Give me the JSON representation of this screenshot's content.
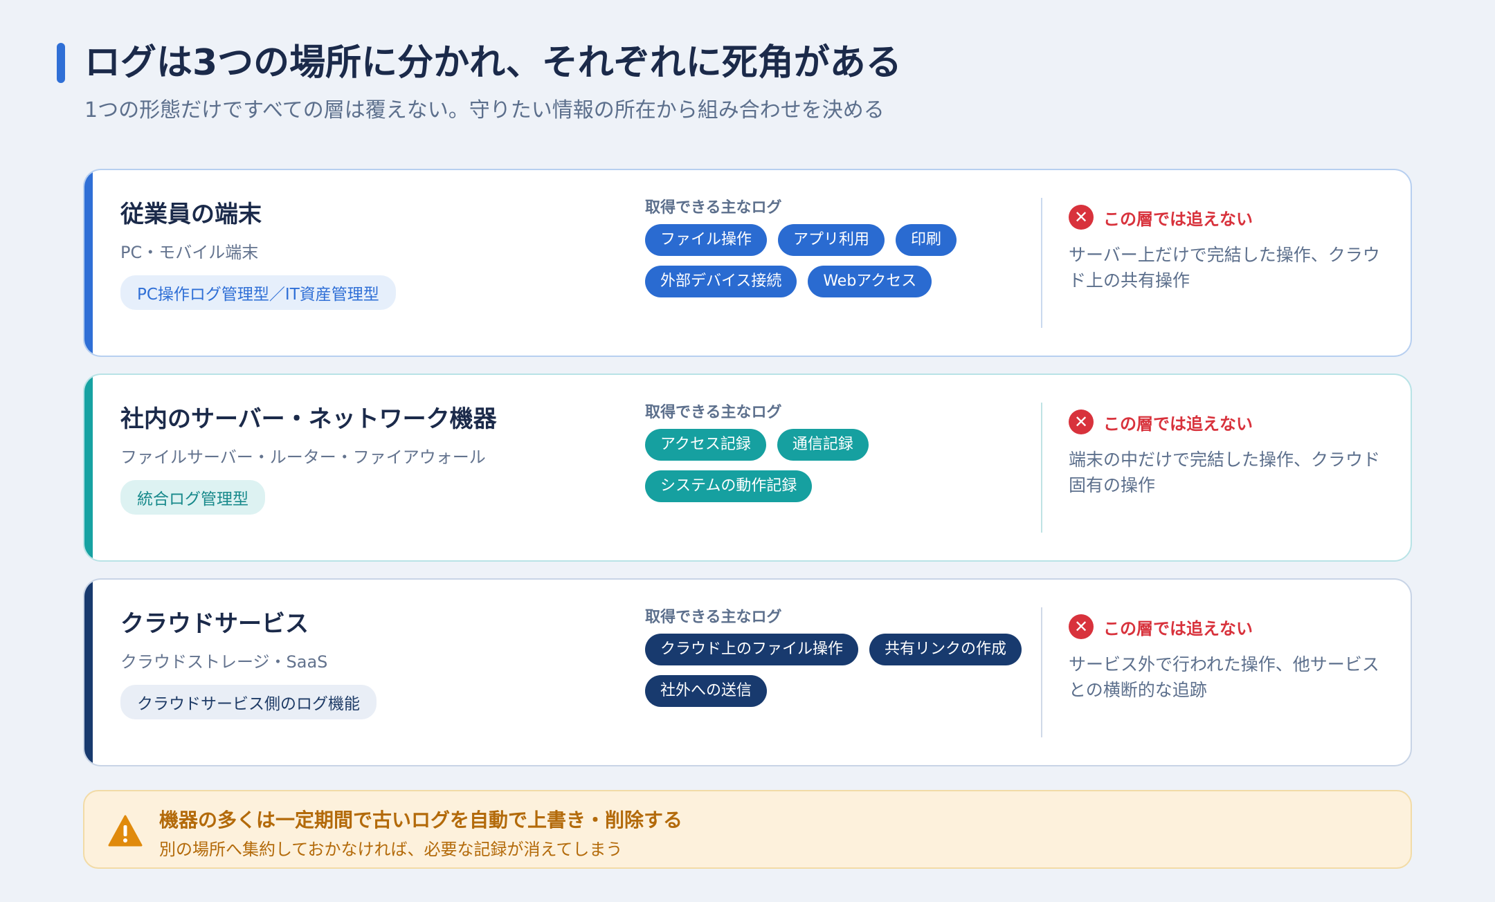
{
  "header": {
    "title": "ログは3つの場所に分かれ、それぞれに死角がある",
    "subtitle": "1つの形態だけですべての層は覆えない。守りたい情報の所在から組み合わせを決める"
  },
  "cards": [
    {
      "title": "従業員の端末",
      "subtitle": "PC・モバイル端末",
      "type_tag": "PC操作ログ管理型／IT資産管理型",
      "logs_label": "取得できる主なログ",
      "logs": [
        "ファイル操作",
        "アプリ利用",
        "印刷",
        "外部デバイス接続",
        "Webアクセス"
      ],
      "blind_label": "この層では追えない",
      "blind_text": "サーバー上だけで完結した操作、クラウド上の共有操作",
      "accent_color": "#2f6fd6"
    },
    {
      "title": "社内のサーバー・ネットワーク機器",
      "subtitle": "ファイルサーバー・ルーター・ファイアウォール",
      "type_tag": "統合ログ管理型",
      "logs_label": "取得できる主なログ",
      "logs": [
        "アクセス記録",
        "通信記録",
        "システムの動作記録"
      ],
      "blind_label": "この層では追えない",
      "blind_text": "端末の中だけで完結した操作、クラウド固有の操作",
      "accent_color": "#17a2a2"
    },
    {
      "title": "クラウドサービス",
      "subtitle": "クラウドストレージ・SaaS",
      "type_tag": "クラウドサービス側のログ機能",
      "logs_label": "取得できる主なログ",
      "logs": [
        "クラウド上のファイル操作",
        "共有リンクの作成",
        "社外への送信"
      ],
      "blind_label": "この層では追えない",
      "blind_text": "サービス外で行われた操作、他サービスとの横断的な追跡",
      "accent_color": "#183a6e"
    }
  ],
  "notice": {
    "icon": "warning-icon",
    "title": "機器の多くは一定期間で古いログを自動で上書き・削除する",
    "text": "別の場所へ集約しておかなければ、必要な記録が消えてしまう"
  }
}
